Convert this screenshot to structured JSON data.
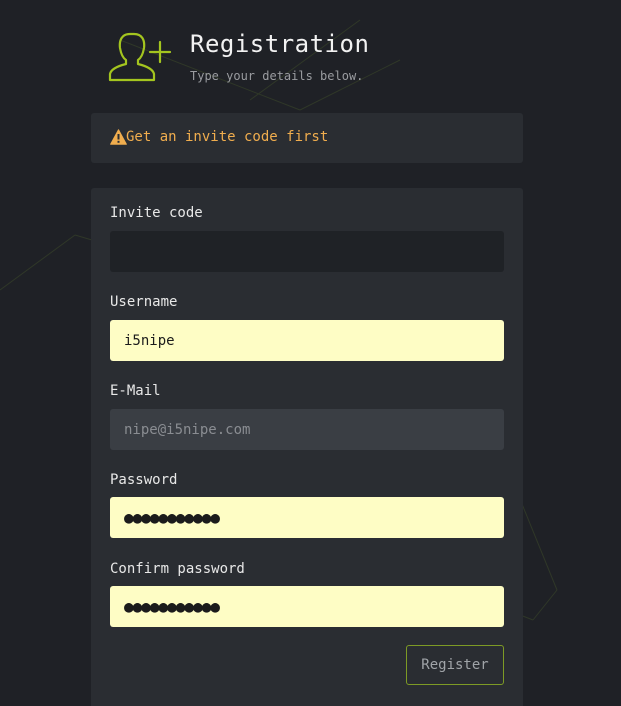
{
  "header": {
    "title": "Registration",
    "subtitle": "Type your details below.",
    "icon": "add-user-icon",
    "accent_color": "#a4c51f"
  },
  "alert": {
    "icon": "warning-icon",
    "text": "Get an invite code first",
    "color": "#f0ad4e"
  },
  "form": {
    "invite_code": {
      "label": "Invite code",
      "value": ""
    },
    "username": {
      "label": "Username",
      "value": "i5nipe"
    },
    "email": {
      "label": "E-Mail",
      "value": "",
      "placeholder": "nipe@i5nipe.com"
    },
    "password": {
      "label": "Password",
      "masked_value": "●●●●●●●●●●●"
    },
    "confirm_password": {
      "label": "Confirm password",
      "masked_value": "●●●●●●●●●●●"
    },
    "register_label": "Register"
  }
}
